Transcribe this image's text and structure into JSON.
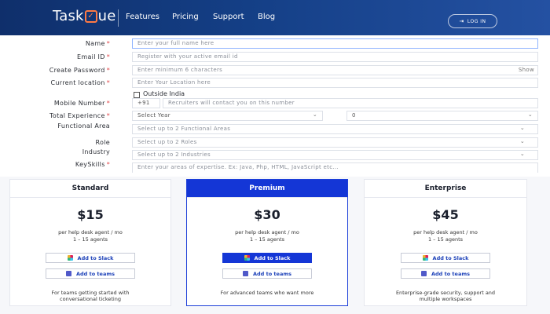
{
  "header": {
    "logo_pre": "Task",
    "logo_post": "ue",
    "nav": [
      "Features",
      "Pricing",
      "Support",
      "Blog"
    ],
    "login_label": "LOG IN"
  },
  "form": {
    "name_label": "Name",
    "name_placeholder": "Enter your full name here",
    "email_label": "Email ID",
    "email_placeholder": "Register with your active email id",
    "password_label": "Create Password",
    "password_placeholder": "Enter minimum 6 characters",
    "password_show": "Show",
    "location_label": "Current location",
    "location_placeholder": "Enter Your Location here",
    "outside_india_label": "Outside India",
    "mobile_label": "Mobile Number",
    "country_code": "+91",
    "mobile_placeholder": "Recruiters will contact you on this number",
    "experience_label": "Total Experience",
    "experience_year": "Select Year",
    "experience_month": "0",
    "functional_label": "Functional Area",
    "functional_placeholder": "Select up to 2 Functional Areas",
    "role_label": "Role",
    "role_placeholder": "Select up to 2 Roles",
    "industry_label": "Industry",
    "industry_placeholder": "Select up to 2 Industries",
    "keyskills_label": "KeySkills",
    "keyskills_placeholder": "Enter your areas of expertise. Ex: Java, Php, HTML, JavaScript etc...",
    "required_marker": "*"
  },
  "pricing": {
    "plans": [
      {
        "name": "Standard",
        "price": "$15",
        "per": "per help desk agent / mo",
        "agents": "1 – 15 agents",
        "slack": "Add to Slack",
        "teams": "Add to teams",
        "desc_line1": "For teams getting started with",
        "desc_line2": "conversational ticketing"
      },
      {
        "name": "Premium",
        "price": "$30",
        "per": "per help desk agent / mo",
        "agents": "1 – 15 agents",
        "slack": "Add to Slack",
        "teams": "Add to teams",
        "desc_line1": "For advanced teams who want more",
        "desc_line2": ""
      },
      {
        "name": "Enterprise",
        "price": "$45",
        "per": "per help desk agent / mo",
        "agents": "1 – 15 agents",
        "slack": "Add to Slack",
        "teams": "Add to teams",
        "desc_line1": "Enterprise-grade security, support and",
        "desc_line2": "multiple workspaces"
      }
    ]
  },
  "colors": {
    "header": "#143f86",
    "premium": "#1436d6",
    "accent": "#ff7a45"
  }
}
